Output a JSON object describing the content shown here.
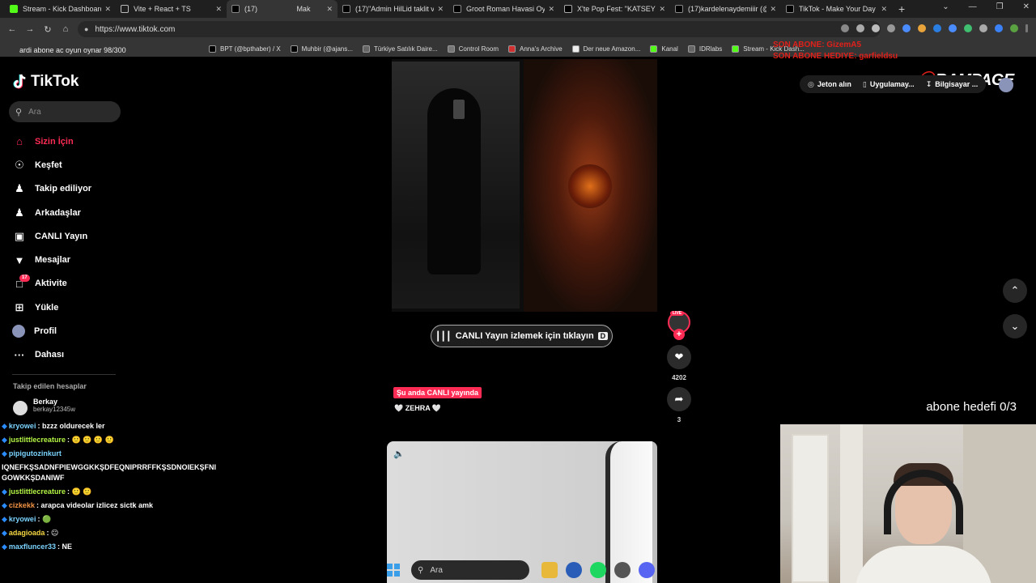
{
  "tabs": [
    {
      "label": "Stream - Kick Dashboard",
      "icon": "kick-icon",
      "active": false
    },
    {
      "label": "Vite + React + TS",
      "icon": "globe-icon",
      "active": false
    },
    {
      "label": "(17)",
      "label2": "Mak",
      "icon": "tiktok-icon",
      "active": true
    },
    {
      "label": "(17)\"Admin HilLid taklit vi",
      "icon": "tiktok-icon",
      "active": false
    },
    {
      "label": "Groot Roman Havasi Oyn",
      "icon": "tiktok-icon",
      "active": false
    },
    {
      "label": "X'te Pop Fest: \"KATSEYE'd",
      "icon": "x-icon",
      "active": false
    },
    {
      "label": "(17)kardelenaydemiiir (@",
      "icon": "tiktok-icon",
      "active": false
    },
    {
      "label": "TikTok - Make Your Day",
      "icon": "tiktok-icon",
      "active": false
    }
  ],
  "browser": {
    "url": "https://www.tiktok.com",
    "new_tab": "+",
    "bookmarks": [
      {
        "label": "BPT (@bpthaber) / X",
        "icon": "x-icon"
      },
      {
        "label": "Muhbir (@ajans...",
        "icon": "x-icon"
      },
      {
        "label": "Türkiye Satılık Daire...",
        "icon": "globe-icon"
      },
      {
        "label": "Control Room",
        "icon": "gear-icon"
      },
      {
        "label": "Anna's Archive",
        "icon": "anna-icon"
      },
      {
        "label": "Der neue Amazon...",
        "icon": "amazon-icon"
      },
      {
        "label": "Kanal",
        "icon": "kick-icon"
      },
      {
        "label": "IDRlabs",
        "icon": "globe-icon"
      },
      {
        "label": "Stream - Kick Dash...",
        "icon": "kick-icon"
      }
    ]
  },
  "overlay": {
    "ticker": "ardi abone ac oyun oynar 98/300",
    "alert_line1": "SON ABONE: GizemA5",
    "alert_line2": "SON ABONE HEDIYE: garfieldsu",
    "brand": "RAMPAGE",
    "sub_goal": "abone hedefi 0/3"
  },
  "tiktok": {
    "logo": "TikTok",
    "search_placeholder": "Ara",
    "nav": [
      {
        "label": "Sizin İçin",
        "icon": "home-icon",
        "active": true
      },
      {
        "label": "Keşfet",
        "icon": "compass-icon",
        "active": false
      },
      {
        "label": "Takip ediliyor",
        "icon": "following-icon",
        "active": false
      },
      {
        "label": "Arkadaşlar",
        "icon": "friends-icon",
        "active": false
      },
      {
        "label": "CANLI Yayın",
        "icon": "live-tv-icon",
        "active": false
      },
      {
        "label": "Mesajlar",
        "icon": "send-icon",
        "active": false
      },
      {
        "label": "Aktivite",
        "icon": "activity-icon",
        "active": false,
        "badge": "17"
      },
      {
        "label": "Yükle",
        "icon": "upload-icon",
        "active": false
      },
      {
        "label": "Profil",
        "icon": "profile-avatar-icon",
        "active": false
      },
      {
        "label": "Dahası",
        "icon": "more-icon",
        "active": false
      }
    ],
    "following_title": "Takip edilen hesaplar",
    "following": [
      {
        "name": "Berkay",
        "handle": "berkay12345w"
      }
    ],
    "header": {
      "coins": "Jeton alın",
      "app": "Uygulamay...",
      "pc": "Bilgisayar ..."
    },
    "live_button": "CANLI Yayın izlemek için tıklayın",
    "live_button_key": "D",
    "live_tag": "LIVE",
    "like_count": "4202",
    "share_count": "3",
    "now_live": "Şu anda CANLI yayında",
    "caption": "🤍 ZEHRA 🤍"
  },
  "chat": [
    {
      "user": "kryowei",
      "text": ": bzzz oldurecek ler",
      "color": "#7bd3ff"
    },
    {
      "user": "justlittlecreature",
      "text": ": 🙂 🙂 🙂 🙂",
      "color": "#b5f545"
    },
    {
      "user": "pipigutozinkurt",
      "text": "",
      "color": "#7bd3ff"
    },
    {
      "user": "",
      "text": "IQNEFKŞSADNFPIEWGGKKŞDFEQNIPRRFFKŞSDNOIEKŞFNI GOWKKŞDANIWF",
      "color": "#fff"
    },
    {
      "user": "justlittlecreature",
      "text": ": 🙂 🙂",
      "color": "#b5f545"
    },
    {
      "user": "cizkekk",
      "text": ": arapca videolar izlicez sictk amk",
      "color": "#f59445"
    },
    {
      "user": "kryowei",
      "text": ": 🟢",
      "color": "#7bd3ff"
    },
    {
      "user": "adagioada",
      "text": ": 😐",
      "color": "#f5d742"
    },
    {
      "user": "maxfluncer33",
      "text": ": NE",
      "color": "#7bd3ff"
    }
  ],
  "taskbar": {
    "search_placeholder": "Ara"
  },
  "colors": {
    "tiktok_red": "#fe2c55",
    "kick_green": "#53fc18",
    "alert_red": "#e0201a"
  }
}
